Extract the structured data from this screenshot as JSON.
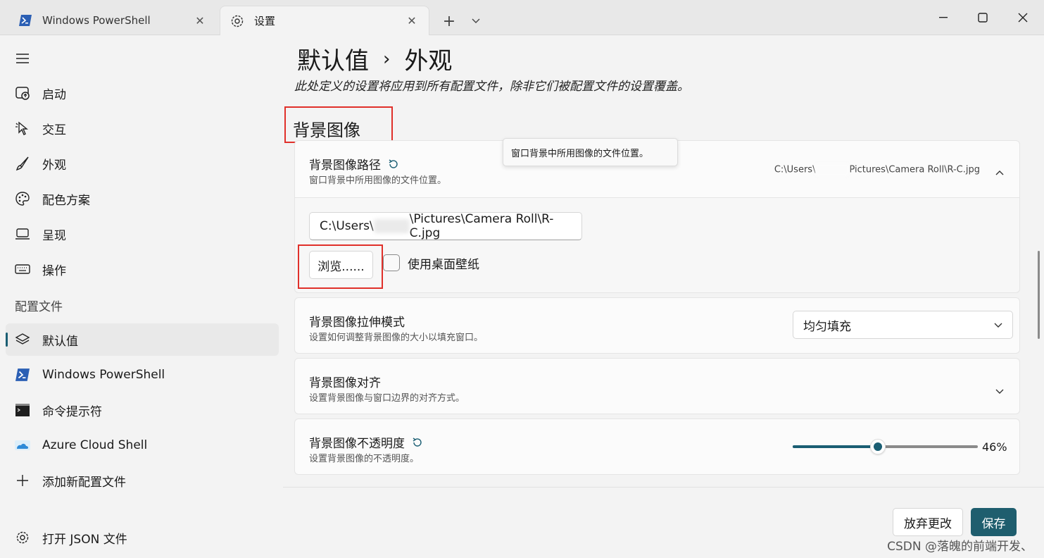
{
  "tabs": [
    {
      "label": "Windows PowerShell",
      "icon": "powershell-icon",
      "active": false
    },
    {
      "label": "设置",
      "icon": "gear-icon",
      "active": true
    }
  ],
  "sidebar": {
    "items": [
      {
        "label": "启动",
        "icon": "launch-icon"
      },
      {
        "label": "交互",
        "icon": "interaction-icon"
      },
      {
        "label": "外观",
        "icon": "brush-icon"
      },
      {
        "label": "配色方案",
        "icon": "palette-icon"
      },
      {
        "label": "呈现",
        "icon": "rendering-icon"
      },
      {
        "label": "操作",
        "icon": "keyboard-icon"
      }
    ],
    "profiles_header": "配置文件",
    "profiles": [
      {
        "label": "默认值",
        "icon": "layers-icon",
        "selected": true
      },
      {
        "label": "Windows PowerShell",
        "icon": "powershell-icon"
      },
      {
        "label": "命令提示符",
        "icon": "cmd-icon"
      },
      {
        "label": "Azure Cloud Shell",
        "icon": "azure-icon"
      },
      {
        "label": "添加新配置文件",
        "icon": "plus-icon"
      }
    ],
    "open_json": "打开 JSON 文件"
  },
  "main": {
    "breadcrumb_parent": "默认值",
    "breadcrumb_sep": "›",
    "breadcrumb_current": "外观",
    "description": "此处定义的设置将应用到所有配置文件，除非它们被配置文件的设置覆盖。",
    "section_title": "背景图像",
    "bg_path": {
      "title": "背景图像路径",
      "subtitle": "窗口背景中所用图像的文件位置。",
      "value_prefix": "C:\\Users\\",
      "value_suffix": "Pictures\\Camera Roll\\R-C.jpg",
      "input_prefix": "C:\\Users\\",
      "input_suffix": "\\Pictures\\Camera Roll\\R-C.jpg",
      "browse_label": "浏览......",
      "wallpaper_label": "使用桌面壁纸",
      "tooltip": "窗口背景中所用图像的文件位置。"
    },
    "stretch": {
      "title": "背景图像拉伸模式",
      "subtitle": "设置如何调整背景图像的大小以填充窗口。",
      "value": "均匀填充"
    },
    "align": {
      "title": "背景图像对齐",
      "subtitle": "设置背景图像与窗口边界的对齐方式。"
    },
    "opacity": {
      "title": "背景图像不透明度",
      "subtitle": "设置背景图像的不透明度。",
      "value": 0.46,
      "value_label": "46%"
    }
  },
  "footer": {
    "discard_label": "放弃更改",
    "save_label": "保存"
  },
  "watermark": "CSDN @落魄的前端开发、",
  "colors": {
    "accent": "#1a5e73",
    "save_button": "#1f5e6e",
    "highlight_box": "#e0302a"
  }
}
